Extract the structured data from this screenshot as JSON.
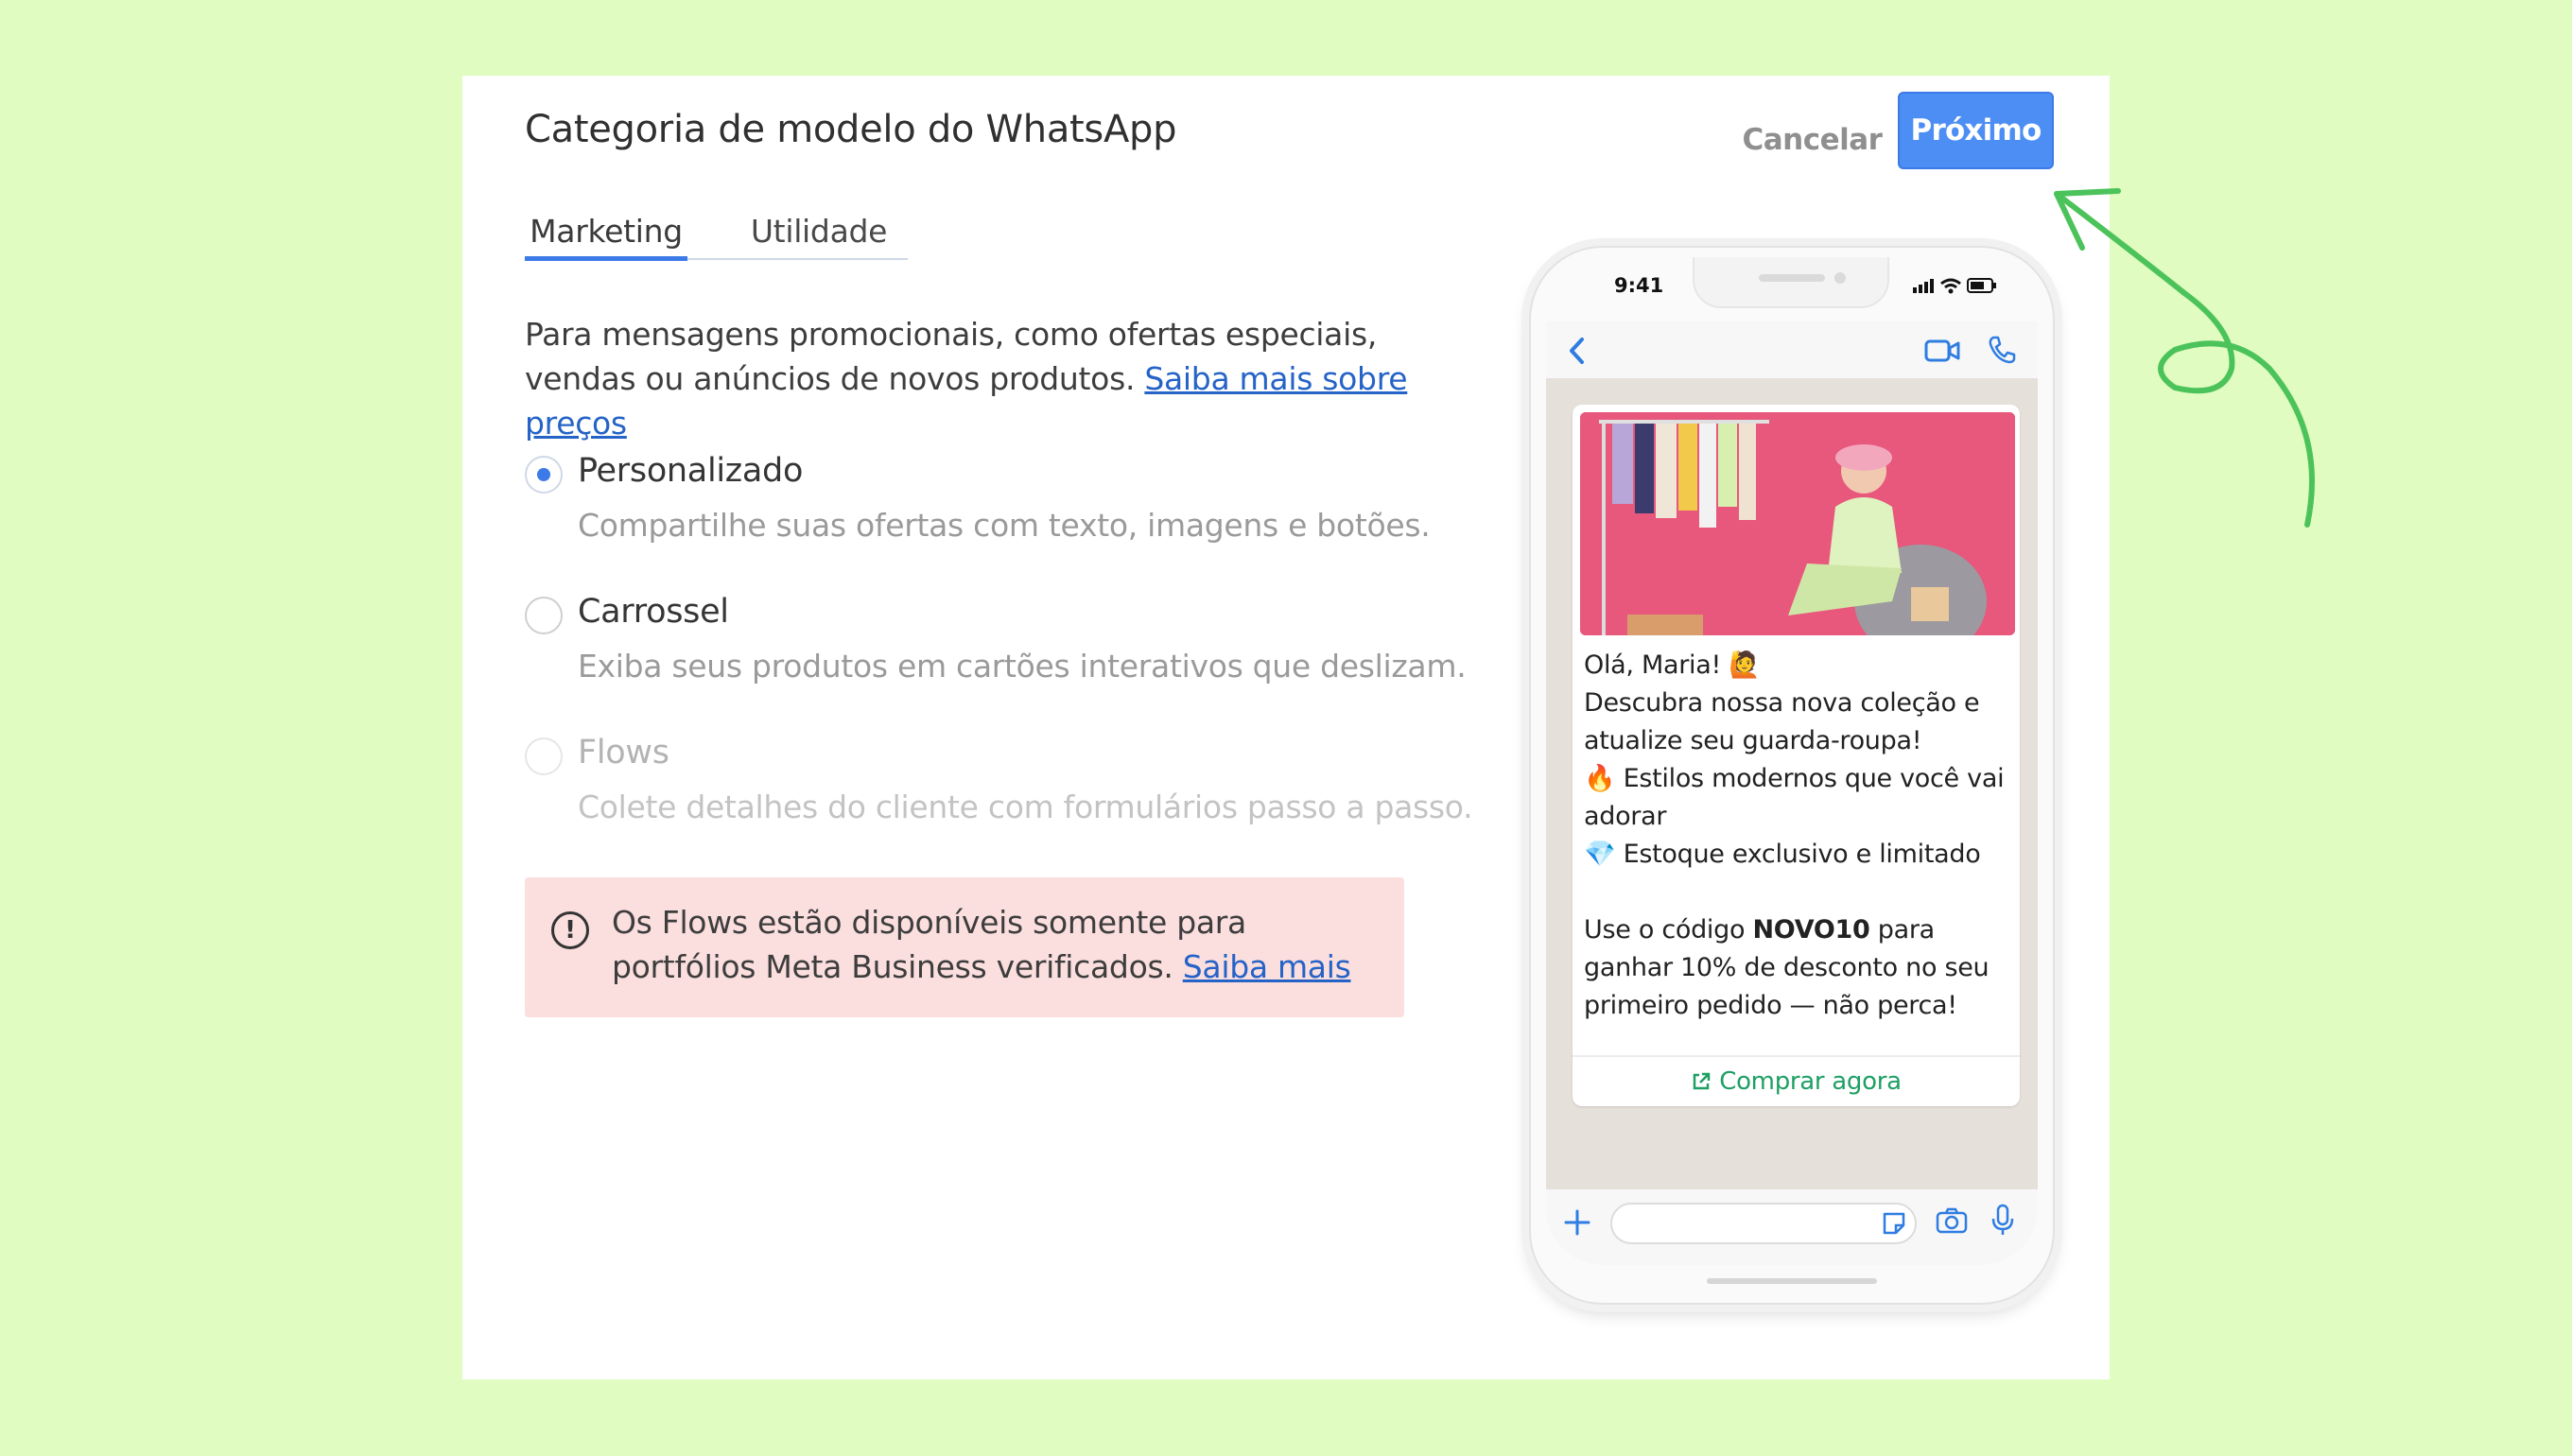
{
  "header": {
    "title": "Categoria de modelo do WhatsApp",
    "cancel_label": "Cancelar",
    "next_label": "Próximo"
  },
  "tabs": [
    {
      "label": "Marketing",
      "active": true
    },
    {
      "label": "Utilidade",
      "active": false
    }
  ],
  "description": {
    "text": "Para mensagens promocionais, como ofertas especiais, vendas ou anúncios de novos produtos.",
    "link": "Saiba mais sobre preços"
  },
  "options": [
    {
      "label": "Personalizado",
      "sub": "Compartilhe suas ofertas com texto, imagens e botões.",
      "selected": true,
      "disabled": false
    },
    {
      "label": "Carrossel",
      "sub": "Exiba seus produtos em cartões interativos que deslizam.",
      "selected": false,
      "disabled": false
    },
    {
      "label": "Flows",
      "sub": "Colete detalhes do cliente com formulários passo a passo.",
      "selected": false,
      "disabled": true
    }
  ],
  "alert": {
    "text": "Os Flows estão disponíveis somente para portfólios Meta Business verificados.",
    "link": "Saiba mais"
  },
  "phone": {
    "time": "9:41",
    "message": {
      "line1": "Olá, Maria! 🙋",
      "line2": "Descubra nossa nova coleção e atualize seu guarda-roupa!",
      "line3": "🔥 Estilos modernos que você vai adorar",
      "line4": "💎 Estoque exclusivo e limitado",
      "line5_pre": "Use o código ",
      "line5_code": "NOVO10",
      "line5_post": " para ganhar 10% de desconto no seu primeiro pedido — não perca!"
    },
    "cta_label": "Comprar agora"
  },
  "colors": {
    "background": "#e0fcc0",
    "accent": "#4d8ef5",
    "alert_bg": "#fbdede",
    "cta_green": "#1e9f64",
    "annotation_arrow": "#4cc35a"
  }
}
